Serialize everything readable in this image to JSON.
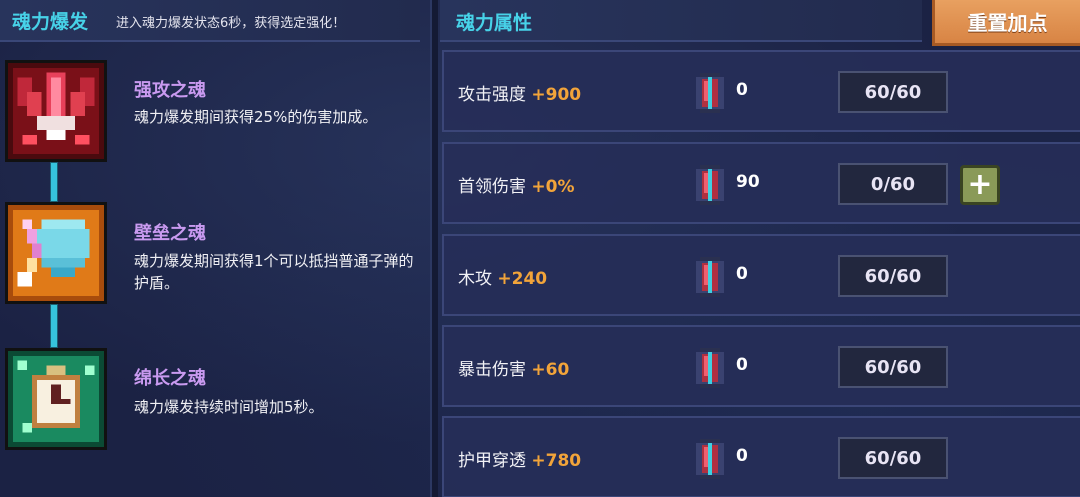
{
  "left_panel": {
    "title": "魂力爆发",
    "subtitle": "进入魂力爆发状态6秒，获得选定强化！",
    "souls": [
      {
        "name": "强攻之魂",
        "desc": "魂力爆发期间获得25%的伤害加成。",
        "icon": "red-wing-ship-icon"
      },
      {
        "name": "壁垒之魂",
        "desc": "魂力爆发期间获得1个可以抵挡普通子弹的护盾。",
        "icon": "shield-sword-icon"
      },
      {
        "name": "绵长之魂",
        "desc": "魂力爆发持续时间增加5秒。",
        "icon": "stopwatch-icon"
      }
    ]
  },
  "right_panel": {
    "title": "魂力属性",
    "reset_label": "重置加点",
    "attributes": [
      {
        "name": "攻击强度",
        "bonus": "+900",
        "gem_count": "0",
        "level": "60/60",
        "has_plus": false
      },
      {
        "name": "首领伤害",
        "bonus": "+0%",
        "gem_count": "90",
        "level": "0/60",
        "has_plus": true
      },
      {
        "name": "木攻",
        "bonus": "+240",
        "gem_count": "0",
        "level": "60/60",
        "has_plus": false
      },
      {
        "name": "暴击伤害",
        "bonus": "+60",
        "gem_count": "0",
        "level": "60/60",
        "has_plus": false
      },
      {
        "name": "护甲穿透",
        "bonus": "+780",
        "gem_count": "0",
        "level": "60/60",
        "has_plus": false
      }
    ]
  },
  "colors": {
    "accent_cyan": "#47d2e8",
    "soul_name": "#c99af0",
    "bonus_orange": "#f2a43a",
    "reset_button": "#e09050"
  }
}
